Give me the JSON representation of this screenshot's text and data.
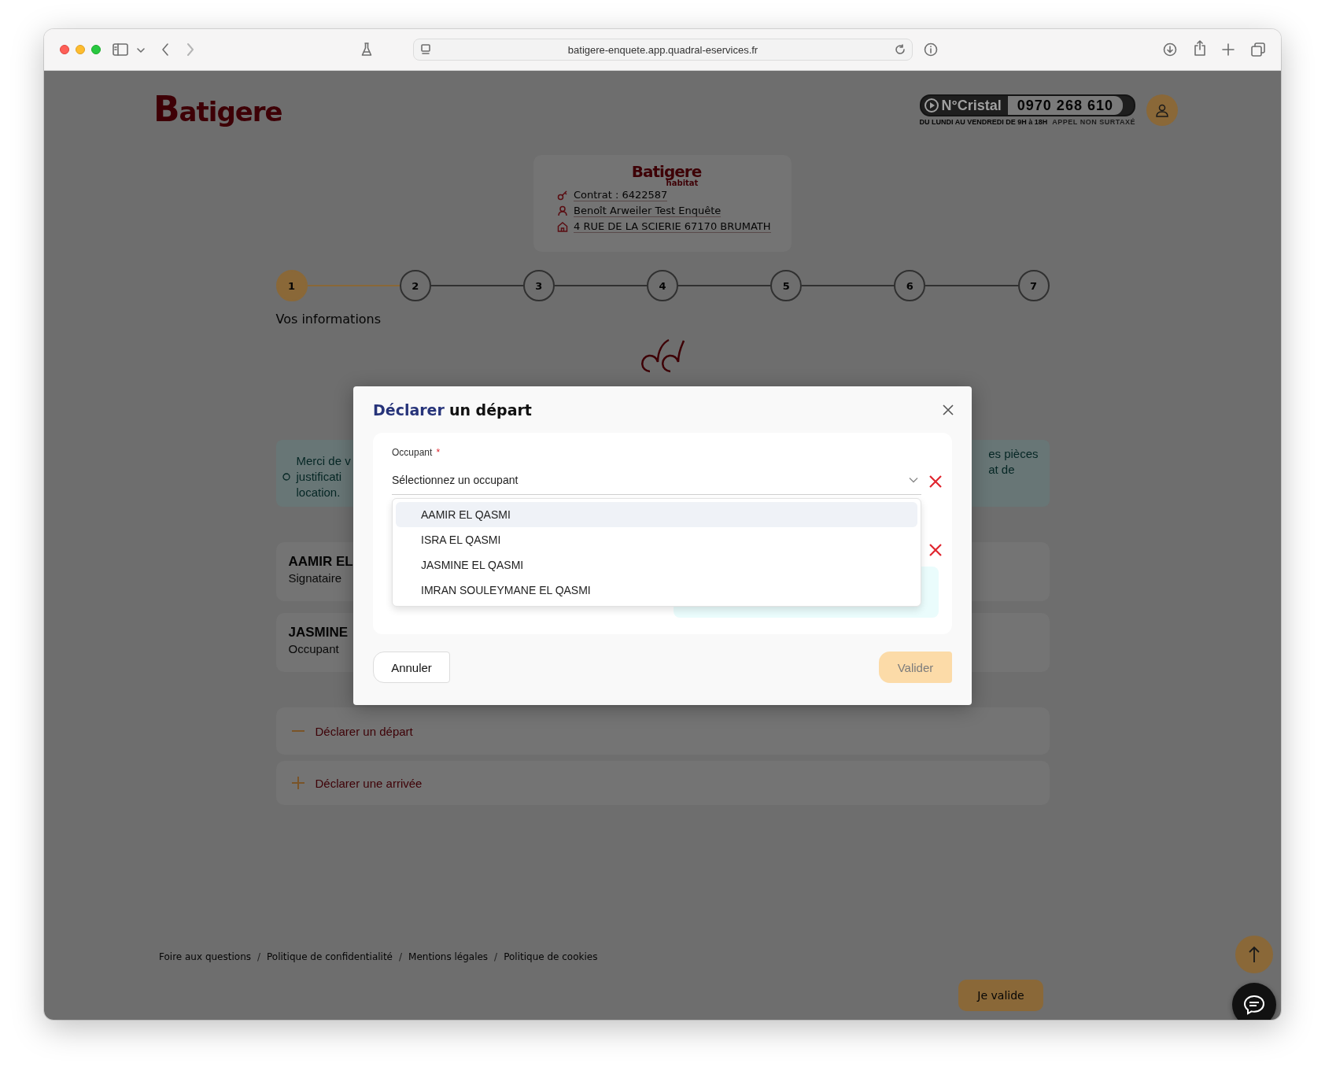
{
  "browser": {
    "url": "batigere-enquete.app.quadral-eservices.fr"
  },
  "header": {
    "logo": "Batigere",
    "hotline": {
      "brand": "N°Cristal",
      "number": "0970 268 610",
      "hours": "DU LUNDI AU VENDREDI DE 9H à 18H",
      "note": "APPEL NON SURTAXÉ"
    }
  },
  "contract_card": {
    "logo": "Batigere",
    "logo_sub": "habitat",
    "lines": [
      {
        "kind": "key",
        "text": "Contrat : 6422587"
      },
      {
        "kind": "person",
        "text": "Benoît Arweiler Test Enquête"
      },
      {
        "kind": "home",
        "text": "4 RUE DE LA SCIERIE 67170 BRUMATH"
      }
    ]
  },
  "stepper": {
    "steps": [
      {
        "label": "1",
        "selected": true
      },
      {
        "label": "2",
        "selected": false
      },
      {
        "label": "3",
        "selected": false
      },
      {
        "label": "4",
        "selected": false
      },
      {
        "label": "5",
        "selected": false
      },
      {
        "label": "6",
        "selected": false
      },
      {
        "label": "7",
        "selected": false
      }
    ],
    "current_title": "Vos informations"
  },
  "notice": {
    "left_lines": [
      "Merci de v",
      "justificati",
      "location."
    ],
    "right_lines": [
      "es pièces",
      "at de"
    ]
  },
  "occupants": [
    {
      "name": "AAMIR EL",
      "role": "Signataire"
    },
    {
      "name": "JASMINE",
      "role": "Occupant"
    }
  ],
  "actions": [
    {
      "kind": "remove",
      "label": "Déclarer un départ"
    },
    {
      "kind": "add",
      "label": "Déclarer une arrivée"
    }
  ],
  "footer": {
    "links": [
      "Foire aux questions",
      "Politique de confidentialité",
      "Mentions légales",
      "Politique de cookies"
    ],
    "separator": "/",
    "submit": "Je valide"
  },
  "modal": {
    "title_highlight": "Déclarer",
    "title_rest": "un départ",
    "field": {
      "label": "Occupant",
      "required_mark": "*",
      "placeholder": "Sélectionnez un occupant",
      "expanded": true
    },
    "options": [
      {
        "label": "AAMIR EL QASMI",
        "selected": true
      },
      {
        "label": "ISRA EL QASMI",
        "selected": false
      },
      {
        "label": "JASMINE EL QASMI",
        "selected": false
      },
      {
        "label": "IMRAN SOULEYMANE EL QASMI",
        "selected": false
      }
    ],
    "cancel": "Annuler",
    "confirm": {
      "label": "Valider",
      "disabled": true
    }
  }
}
